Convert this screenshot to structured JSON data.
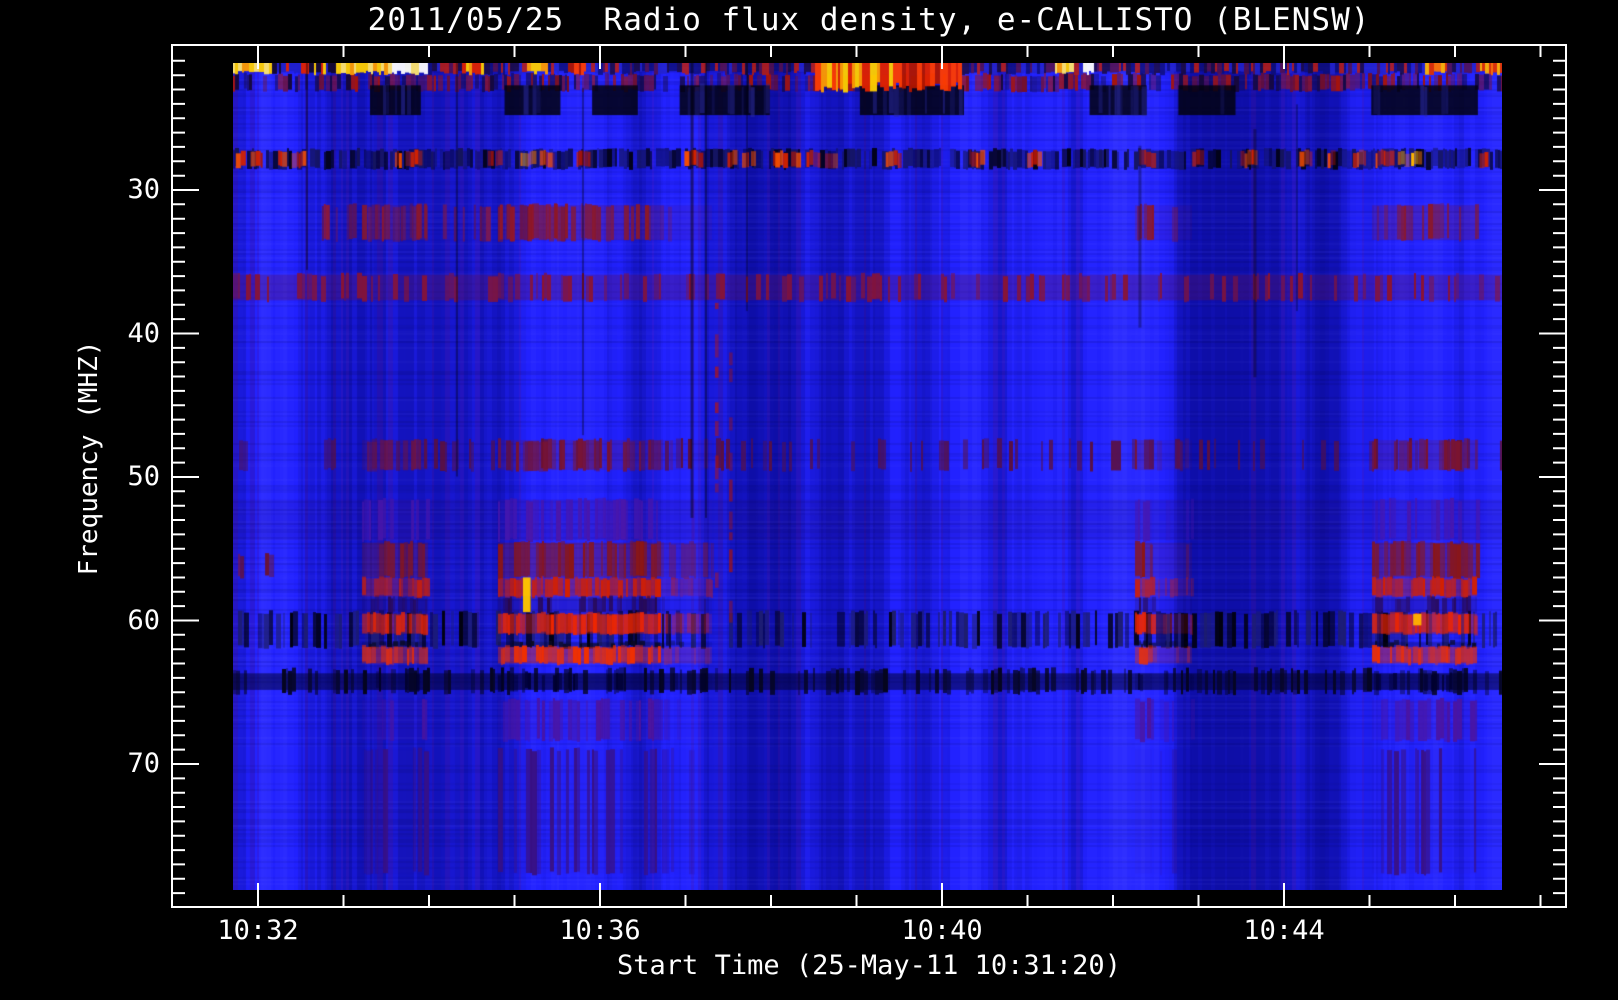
{
  "chart_data": {
    "type": "heatmap",
    "title": "2011/05/25  Radio flux density, e-CALLISTO (BLENSW)",
    "xlabel": "Start Time (25-May-11 10:31:20)",
    "ylabel": "Frequency (MHZ)",
    "x_tick_labels": [
      "10:32",
      "10:36",
      "10:40",
      "10:44"
    ],
    "y_tick_labels": [
      "30",
      "40",
      "50",
      "60",
      "70"
    ],
    "x_axis": {
      "unit": "time",
      "major_step_minutes": 4,
      "minor_step_minutes": 1,
      "start_label": "10:31:20"
    },
    "y_axis": {
      "unit": "MHz",
      "estimated_range": [
        20,
        80
      ],
      "inverted": true,
      "major_step": 10,
      "minor_step": 1
    },
    "legend": "none",
    "grid": "off",
    "colormap": {
      "background": "#000000",
      "low": "#1616e6",
      "mid": "#8a1420",
      "high": "#ee2600",
      "peak": "#ffd000",
      "max": "#ffffff",
      "axis": "#ffffff"
    },
    "texture": {
      "base": {
        "color": "#1a1ae0",
        "dark": "#0b0bb4",
        "light": "#3333ff",
        "purple": "#5014a0"
      },
      "rfi_segments": [
        {
          "fx": [
            0.0,
            0.026
          ],
          "kind": "yellow"
        },
        {
          "fx": [
            0.026,
            0.08
          ],
          "kind": "mixed"
        },
        {
          "fx": [
            0.08,
            0.119
          ],
          "kind": "yellow"
        },
        {
          "fx": [
            0.119,
            0.152
          ],
          "kind": "white"
        },
        {
          "fx": [
            0.18,
            0.196
          ],
          "kind": "redyellow"
        },
        {
          "fx": [
            0.229,
            0.247
          ],
          "kind": "yellow"
        },
        {
          "fx": [
            0.262,
            0.277
          ],
          "kind": "red"
        },
        {
          "fx": [
            0.457,
            0.52
          ],
          "kind": "redyellow",
          "thick": true
        },
        {
          "fx": [
            0.52,
            0.574
          ],
          "kind": "red",
          "thick": true
        },
        {
          "fx": [
            0.645,
            0.661
          ],
          "kind": "yellow"
        },
        {
          "fx": [
            0.669,
            0.677
          ],
          "kind": "white"
        },
        {
          "fx": [
            0.938,
            0.956
          ],
          "kind": "orange"
        },
        {
          "fx": [
            0.982,
            1.0
          ],
          "kind": "orange"
        }
      ],
      "rows": [
        {
          "name": "rfi-top-red-row",
          "fy": [
            0.014,
            0.033
          ],
          "style": "mottle",
          "colors": [
            "#a81408",
            "#7a0f20",
            "#16083c"
          ],
          "density": 0.8
        },
        {
          "name": "dark-patches-22mhz",
          "fy": [
            0.027,
            0.063
          ],
          "style": "patches",
          "color": "#020210",
          "alpha": 0.85,
          "xs": [
            [
              0.108,
              0.148
            ],
            [
              0.214,
              0.258
            ],
            [
              0.283,
              0.319
            ],
            [
              0.352,
              0.423
            ],
            [
              0.494,
              0.576
            ],
            [
              0.675,
              0.72
            ],
            [
              0.745,
              0.79
            ],
            [
              0.897,
              0.981
            ]
          ]
        },
        {
          "name": "rfi-row-27mhz-dark",
          "fy": [
            0.105,
            0.127
          ],
          "style": "mottle",
          "colors": [
            "#020218",
            "#14145a"
          ],
          "density": 0.85
        },
        {
          "name": "rfi-row-27mhz-red",
          "fy": [
            0.107,
            0.125
          ],
          "style": "blobs",
          "colors": [
            "#d42200",
            "#a81408",
            "#ff5000"
          ],
          "w": [
            0.004,
            0.013
          ],
          "xs": [
            0.005,
            0.018,
            0.038,
            0.052,
            0.13,
            0.142,
            0.205,
            0.247,
            0.276,
            0.362,
            0.392,
            0.405,
            0.43,
            0.444,
            0.457,
            0.47,
            0.52,
            0.585,
            0.63,
            0.72,
            0.76,
            0.8,
            0.845,
            0.865,
            0.887,
            0.906,
            0.985
          ]
        },
        {
          "name": "rfi-row-27mhz-yellow",
          "fy": [
            0.108,
            0.124
          ],
          "style": "blobs",
          "colors": [
            "#ffb400",
            "#ff7a00"
          ],
          "w": [
            0.004,
            0.01
          ],
          "xs": [
            0.2315,
            0.921,
            0.932
          ]
        },
        {
          "name": "red-blobs-32mhz",
          "fy": [
            0.172,
            0.214
          ],
          "fx": [
            0.07,
            0.26
          ],
          "style": "mottle",
          "colors": [
            "#99182a",
            "#64124a"
          ],
          "density": 0.55
        },
        {
          "name": "faint-band-37mhz",
          "fy": [
            0.256,
            0.287
          ],
          "style": "tint",
          "color": "#6e1240",
          "alpha": 0.28
        },
        {
          "name": "faint-band-37mhz-mottle",
          "fy": [
            0.256,
            0.287
          ],
          "style": "mottle",
          "colors": [
            "#8c1430"
          ],
          "density": 0.35
        },
        {
          "name": "faint-row-45mhz",
          "fy": [
            0.456,
            0.492
          ],
          "style": "mottle",
          "colors": [
            "#5a1040"
          ],
          "density": 0.25
        },
        {
          "name": "faint-purple-53mhz",
          "fy": [
            0.528,
            0.577
          ],
          "style": "tint",
          "color": "#2a0c66",
          "alpha": 0.12
        },
        {
          "name": "left-specks-58mhz",
          "fy": [
            0.595,
            0.622
          ],
          "fx": [
            0.004,
            0.055
          ],
          "style": "mottle",
          "colors": [
            "#a01414",
            "#701020"
          ],
          "density": 0.3
        },
        {
          "name": "stipple-row-62mhz",
          "fy": [
            0.664,
            0.706
          ],
          "style": "mottle",
          "colors": [
            "#01010e",
            "#1d1d6e"
          ],
          "density": 0.6
        },
        {
          "name": "dark-band-64mhz",
          "fy": [
            0.738,
            0.758
          ],
          "style": "tint",
          "color": "#000026",
          "alpha": 0.5
        },
        {
          "name": "dark-band-64mhz-mottle",
          "fy": [
            0.733,
            0.762
          ],
          "style": "mottle",
          "colors": [
            "#05051e"
          ],
          "density": 0.4
        }
      ],
      "event_bands": [
        {
          "fy": [
            0.172,
            0.214
          ],
          "color": "#8c1828",
          "alpha": 0.5,
          "mottle": 0.6
        },
        {
          "fy": [
            0.456,
            0.492
          ],
          "color": "#7a1430",
          "alpha": 0.45,
          "mottle": 0.6
        },
        {
          "fy": [
            0.528,
            0.577
          ],
          "color": "#4a16aa",
          "alpha": 0.4,
          "mottle": 0.5
        },
        {
          "fy": [
            0.58,
            0.622
          ],
          "color": "#8c1614",
          "alpha": 0.7,
          "mottle": 0.75
        },
        {
          "fy": [
            0.623,
            0.645
          ],
          "color": "#d42000",
          "alpha": 0.8,
          "mottle": 0.8
        },
        {
          "fy": [
            0.646,
            0.665
          ],
          "color": "#2a0848",
          "alpha": 0.5,
          "mottle": 0.5
        },
        {
          "fy": [
            0.666,
            0.69
          ],
          "color": "#ee2600",
          "alpha": 0.88,
          "mottle": 0.85
        },
        {
          "fy": [
            0.7,
            0.706
          ],
          "color": "#0a0a20",
          "alpha": 0.5,
          "mottle": 0.4
        },
        {
          "fy": [
            0.706,
            0.726
          ],
          "color": "#f03000",
          "alpha": 0.9,
          "mottle": 0.85
        },
        {
          "fy": [
            0.738,
            0.758
          ],
          "color": "#000030",
          "alpha": 0.45,
          "mottle": 0.3
        },
        {
          "fy": [
            0.77,
            0.819
          ],
          "color": "#4c149e",
          "alpha": 0.3,
          "mottle": 0.5
        },
        {
          "fy": [
            0.83,
            0.98
          ],
          "color": "#3a1080",
          "alpha": 0.12,
          "mottle": 0.4
        }
      ],
      "events": [
        {
          "name": "burst-a",
          "fx": [
            0.1017,
            0.1537
          ],
          "strength": 0.85
        },
        {
          "name": "burst-b",
          "fx": [
            0.2088,
            0.3365
          ],
          "strength": 1.0,
          "tail": [
            0.3365,
            0.3775
          ]
        },
        {
          "name": "burst-c",
          "fx": [
            0.7108,
            0.7242
          ],
          "strength": 1.0,
          "tail": [
            0.7242,
            0.7557
          ]
        },
        {
          "name": "burst-d",
          "fx": [
            0.8976,
            0.9803
          ],
          "strength": 1.0
        }
      ],
      "extras": [
        {
          "name": "yellow-streak-b",
          "fx": [
            0.2285,
            0.2345
          ],
          "fy": [
            0.622,
            0.664
          ],
          "color": "#ffc800",
          "alpha": 0.95
        },
        {
          "name": "yellow-spot-d",
          "fx": [
            0.93,
            0.9365
          ],
          "fy": [
            0.666,
            0.68
          ],
          "color": "#ffb400",
          "alpha": 0.95
        },
        {
          "name": "thin-burst-1",
          "fx": [
            0.3798,
            0.3826
          ],
          "fy": [
            0.29,
            0.64
          ],
          "color": "#c01400",
          "alpha": 0.75,
          "dash": true
        },
        {
          "name": "thin-burst-2",
          "fx": [
            0.3909,
            0.3937
          ],
          "fy": [
            0.35,
            0.665
          ],
          "color": "#b01200",
          "alpha": 0.7,
          "dash": true
        }
      ],
      "dark_columns": [
        {
          "fx": 0.0583,
          "fy": [
            0.0,
            0.25
          ],
          "w": 2,
          "alpha": 0.4
        },
        {
          "fx": 0.1765,
          "fy": [
            0.0,
            0.5
          ],
          "w": 2,
          "alpha": 0.35
        },
        {
          "fx": 0.2758,
          "fy": [
            0.03,
            0.45
          ],
          "w": 2,
          "alpha": 0.35
        },
        {
          "fx": 0.3617,
          "fy": [
            0.0,
            0.55
          ],
          "w": 3,
          "alpha": 0.45
        },
        {
          "fx": 0.3727,
          "fy": [
            0.0,
            0.55
          ],
          "w": 2,
          "alpha": 0.4
        },
        {
          "fx": 0.405,
          "fy": [
            0.0,
            0.3
          ],
          "w": 2,
          "alpha": 0.3
        },
        {
          "fx": 0.7147,
          "fy": [
            0.1,
            0.32
          ],
          "w": 3,
          "alpha": 0.3
        },
        {
          "fx": 0.8053,
          "fy": [
            0.08,
            0.38
          ],
          "w": 3,
          "alpha": 0.35
        },
        {
          "fx": 0.8384,
          "fy": [
            0.05,
            0.3
          ],
          "w": 2,
          "alpha": 0.3
        }
      ]
    }
  }
}
